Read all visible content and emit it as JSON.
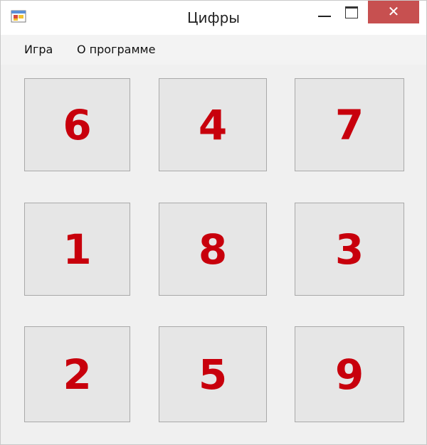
{
  "window": {
    "title": "Цифры",
    "close_glyph": "✕",
    "icon": "app-window-icon"
  },
  "menu": {
    "items": [
      {
        "label": "Игра"
      },
      {
        "label": "О программе"
      }
    ]
  },
  "board": {
    "tiles": [
      "6",
      "4",
      "7",
      "1",
      "8",
      "3",
      "2",
      "5",
      "9"
    ],
    "number_color": "#c8000c"
  }
}
